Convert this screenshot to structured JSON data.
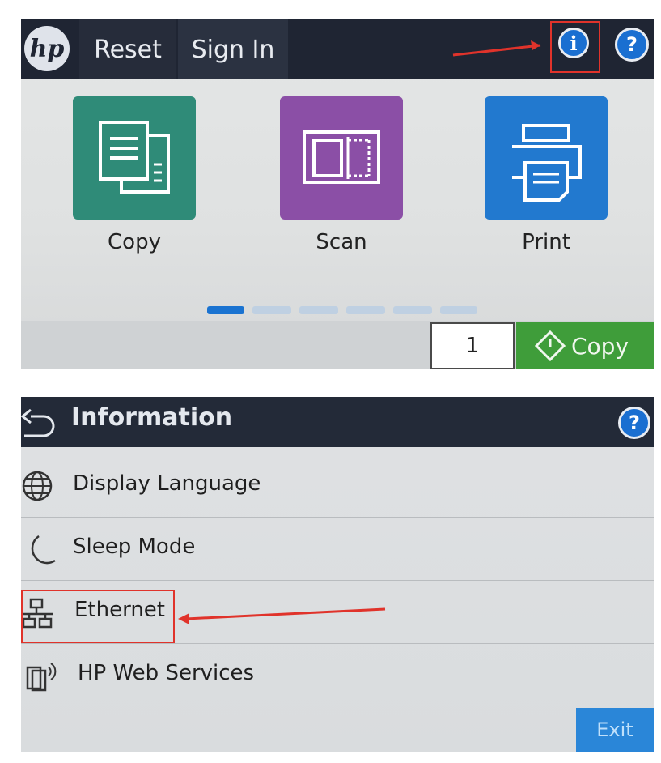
{
  "home_screen": {
    "logo_text": "hp",
    "reset_label": "Reset",
    "signin_label": "Sign In",
    "info_icon_glyph": "i",
    "help_icon_glyph": "?",
    "tiles": [
      {
        "label": "Copy",
        "color": "#2f8b78",
        "icon": "copy-icon"
      },
      {
        "label": "Scan",
        "color": "#8b4fa6",
        "icon": "scan-icon"
      },
      {
        "label": "Print",
        "color": "#2279cf",
        "icon": "printer-icon"
      }
    ],
    "pager": {
      "pages": 6,
      "active": 1
    },
    "copies_value": "1",
    "copy_start_label": "Copy"
  },
  "information_menu": {
    "title": "Information",
    "help_icon_glyph": "?",
    "items": [
      {
        "label": "Display Language",
        "icon": "globe-icon"
      },
      {
        "label": "Sleep Mode",
        "icon": "moon-icon"
      },
      {
        "label": "Ethernet",
        "icon": "network-icon"
      },
      {
        "label": "HP Web Services",
        "icon": "web-services-icon"
      }
    ],
    "exit_label": "Exit"
  },
  "annotations": {
    "highlight_color": "#e0332b"
  }
}
